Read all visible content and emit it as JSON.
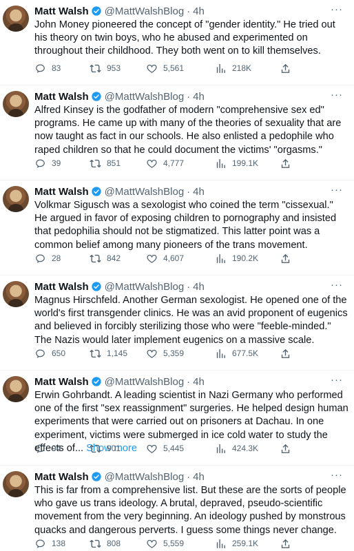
{
  "author": {
    "name": "Matt Walsh",
    "handle": "@MattWalshBlog",
    "dot": "·",
    "time": "4h",
    "verified_color": "#1d9bf0"
  },
  "more_label": "···",
  "tweets": [
    {
      "text": "John Money pioneered the concept of \"gender identity.\" He tried out his theory on twin boys, who he abused and experimented on throughout their childhood. They both went on to kill themselves.",
      "show_more": "",
      "replies": "83",
      "retweets": "953",
      "likes": "5,561",
      "views": "218K"
    },
    {
      "text": "Alfred Kinsey is the godfather of modern \"comprehensive sex ed\" programs. He came up with many of the theories of sexuality that are now taught as fact in our schools. He also enlisted a pedophile who raped children so that he could document the victims' \"orgasms.\"",
      "show_more": "",
      "replies": "39",
      "retweets": "851",
      "likes": "4,777",
      "views": "199.1K"
    },
    {
      "text": "Volkmar Sigusch was a sexologist who coined the term \"cissexual.\" He argued in favor of exposing children to pornography and insisted that pedophilia should not be stigmatized. This latter point was a common belief among many pioneers of the trans movement.",
      "show_more": "",
      "replies": "28",
      "retweets": "842",
      "likes": "4,607",
      "views": "190.2K"
    },
    {
      "text": "Magnus Hirschfeld. Another German sexologist. He opened one of the world's first transgender clinics. He was an avid proponent of eugenics and believed in forcibly sterilizing those who were \"feeble-minded.\" The Nazis would later implement eugenics on a massive scale.",
      "show_more": "",
      "replies": "650",
      "retweets": "1,145",
      "likes": "5,359",
      "views": "677.5K"
    },
    {
      "text": "Erwin Gohrbandt. A leading scientist in Nazi Germany who performed one of the first \"sex reassignment\" surgeries. He helped design human experiments that were carried out on prisoners at Dachau. In one experiment, victims were submerged in ice cold water to study the effects of...",
      "show_more": "Show more",
      "replies": "94",
      "retweets": "901",
      "likes": "5,445",
      "views": "424.3K"
    },
    {
      "text": "This is far from a comprehensive list. But these are the sorts of people who gave us trans ideology. A brutal, depraved, pseudo-scientific movement from the very beginning. An ideology pushed by monstrous quacks and dangerous perverts. I guess some things never change.",
      "show_more": "",
      "replies": "138",
      "retweets": "808",
      "likes": "5,559",
      "views": "259.1K"
    }
  ]
}
